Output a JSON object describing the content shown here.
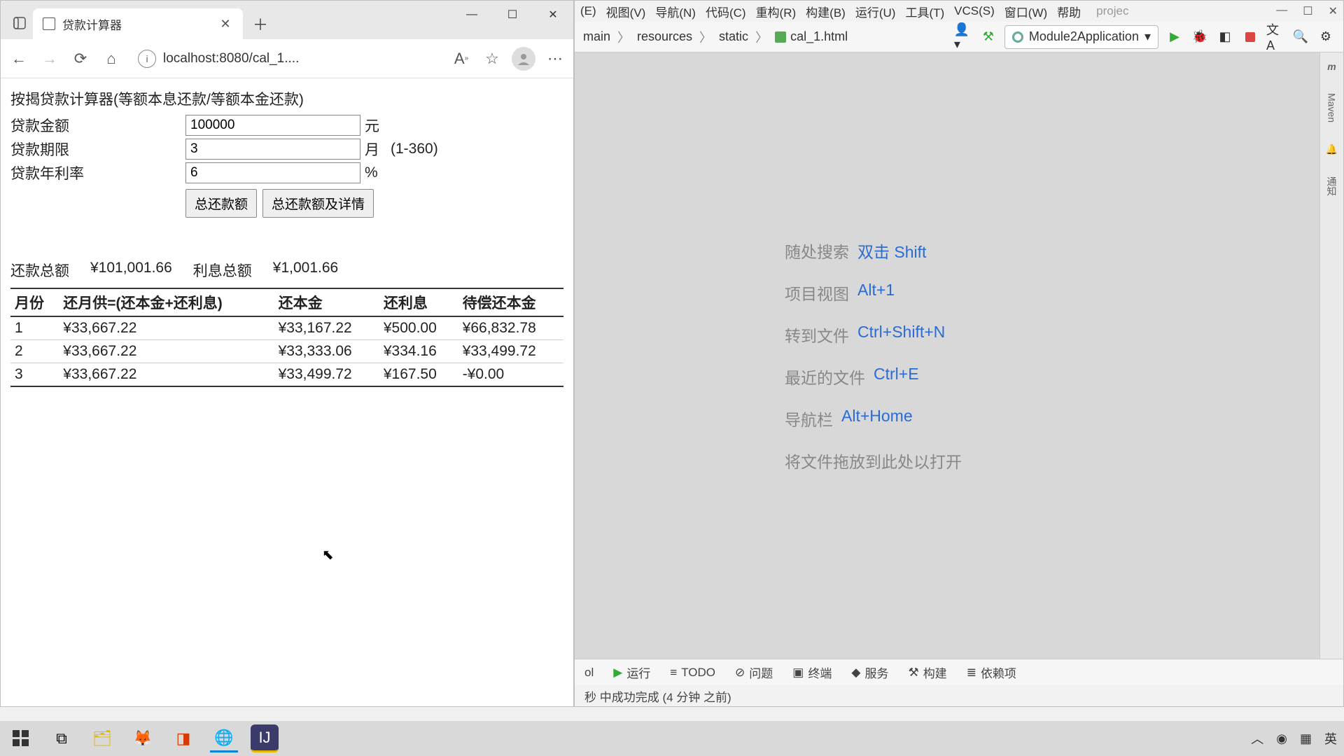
{
  "browser": {
    "tab_title": "贷款计算器",
    "address": "localhost:8080/cal_1....",
    "page": {
      "heading": "按揭贷款计算器(等额本息还款/等额本金还款)",
      "labels": {
        "amount": "贷款金额",
        "term": "贷款期限",
        "rate": "贷款年利率"
      },
      "values": {
        "amount": "100000",
        "term": "3",
        "rate": "6"
      },
      "units": {
        "amount": "元",
        "term": "月",
        "rate": "%"
      },
      "term_hint": "(1-360)",
      "buttons": {
        "total": "总还款额",
        "detail": "总还款额及详情"
      },
      "summary": {
        "total_label": "还款总额",
        "total_value": "¥101,001.66",
        "interest_label": "利息总额",
        "interest_value": "¥1,001.66"
      }
    }
  },
  "chart_data": {
    "type": "table",
    "columns": [
      "月份",
      "还月供=(还本金+还利息)",
      "还本金",
      "还利息",
      "待偿还本金"
    ],
    "rows": [
      [
        "1",
        "¥33,667.22",
        "¥33,167.22",
        "¥500.00",
        "¥66,832.78"
      ],
      [
        "2",
        "¥33,667.22",
        "¥33,333.06",
        "¥334.16",
        "¥33,499.72"
      ],
      [
        "3",
        "¥33,667.22",
        "¥33,499.72",
        "¥167.50",
        "-¥0.00"
      ]
    ]
  },
  "ide": {
    "menus": [
      "(E)",
      "视图(V)",
      "导航(N)",
      "代码(C)",
      "重构(R)",
      "构建(B)",
      "运行(U)",
      "工具(T)",
      "VCS(S)",
      "窗口(W)",
      "帮助"
    ],
    "project_label": "projec",
    "crumbs": [
      "main",
      "resources",
      "static",
      "cal_1.html"
    ],
    "run_config": "Module2Application",
    "hints": [
      {
        "label": "随处搜索",
        "key": "双击 Shift"
      },
      {
        "label": "项目视图",
        "key": "Alt+1"
      },
      {
        "label": "转到文件",
        "key": "Ctrl+Shift+N"
      },
      {
        "label": "最近的文件",
        "key": "Ctrl+E"
      },
      {
        "label": "导航栏",
        "key": "Alt+Home"
      }
    ],
    "drop_hint": "将文件拖放到此处以打开",
    "right_labels": {
      "maven": "Maven",
      "notify": "通知"
    },
    "bottom": {
      "run": "运行",
      "todo": "TODO",
      "problems": "问题",
      "terminal": "终端",
      "services": "服务",
      "build": "构建",
      "deps": "依赖项"
    },
    "status_partial": "秒 中成功完成 (4 分钟 之前)",
    "tool_left": "ol"
  },
  "taskbar": {
    "lang": "英"
  }
}
